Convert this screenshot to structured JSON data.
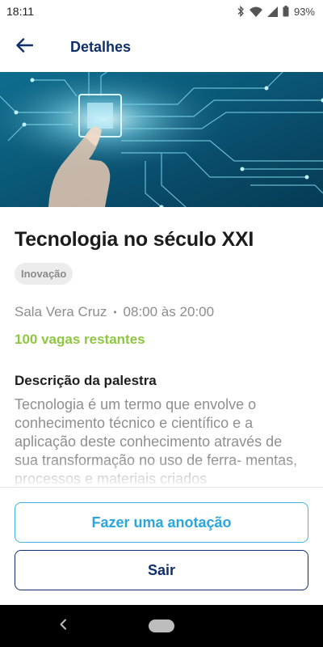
{
  "status_bar": {
    "time": "18:11",
    "battery": "93%",
    "icons": [
      "bluetooth-icon",
      "wifi-icon",
      "signal-icon",
      "battery-icon"
    ]
  },
  "header": {
    "title": "Detalhes",
    "back_icon": "arrow-left-icon"
  },
  "hero": {
    "image": "technology-circuit-hand-image"
  },
  "event": {
    "title": "Tecnologia no século XXI",
    "tag": "Inovação",
    "room": "Sala Vera Cruz",
    "separator": "•",
    "time": "08:00 às 20:00",
    "vacancies": "100 vagas restantes",
    "description_heading": "Descrição da palestra",
    "description": "Tecnologia é um termo que envolve o conhecimento técnico e científico e a aplicação deste conhecimento através de sua transformação no uso de ferra- mentas, processos e materiais criados"
  },
  "actions": {
    "note_label": "Fazer uma anotação",
    "exit_label": "Sair"
  },
  "colors": {
    "primary": "#0f2f6b",
    "accent": "#2aa6df",
    "success": "#8dc63f",
    "muted": "#8f8f8f"
  }
}
